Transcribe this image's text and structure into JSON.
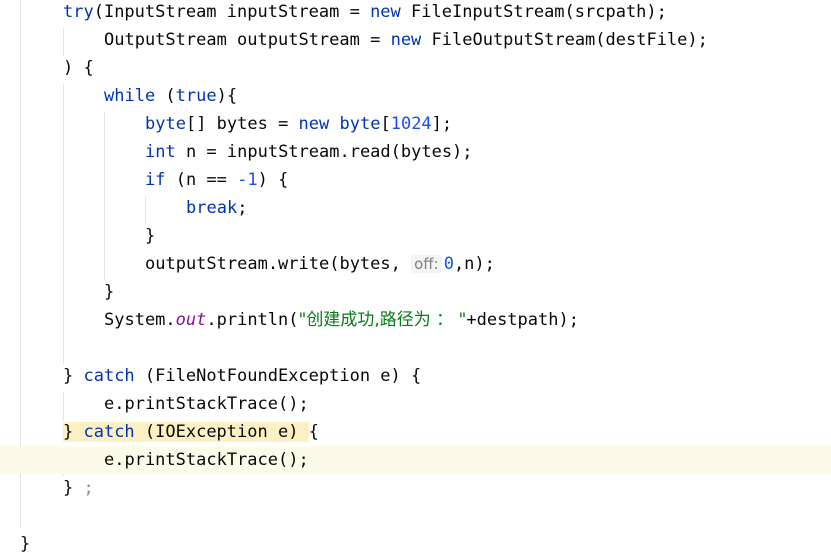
{
  "editor": {
    "lines": {
      "l1": {
        "t1": "try",
        "t2": "(InputStream inputStream = ",
        "t3": "new",
        "t4": " FileInputStream(srcpath);"
      },
      "l2": {
        "t1": "OutputStream outputStream = ",
        "t2": "new",
        "t3": " FileOutputStream(destFile);"
      },
      "l3": {
        "t1": ") {"
      },
      "l4": {
        "t1": "while",
        "t2": " (",
        "t3": "true",
        "t4": "){"
      },
      "l5": {
        "t1": "byte",
        "t2": "[] bytes = ",
        "t3": "new",
        "t4": " ",
        "t5": "byte",
        "t6": "[",
        "t7": "1024",
        "t8": "];"
      },
      "l6": {
        "t1": "int",
        "t2": " n = inputStream.read(bytes);"
      },
      "l7": {
        "t1": "if",
        "t2": " (n == ",
        "t3": "-1",
        "t4": ") {"
      },
      "l8": {
        "t1": "break",
        "t2": ";"
      },
      "l9": {
        "t1": "}"
      },
      "l10": {
        "t1": "outputStream.write(bytes, ",
        "hint": "off:",
        "t2": " ",
        "t3": "0",
        "t4": ",n);"
      },
      "l11": {
        "t1": "}"
      },
      "l12": {
        "t1": "System.",
        "t2": "out",
        "t3": ".println(",
        "t4": "\"创建成功,路径为 ： \"",
        "t5": "+destpath);"
      },
      "l14": {
        "t1": "} ",
        "t2": "catch",
        "t3": " (FileNotFoundException e) {"
      },
      "l15": {
        "t1": "e.printStackTrace();"
      },
      "l16": {
        "t1": "} ",
        "t2": "catch",
        "t3": " (IOException e) ",
        "t4": "{"
      },
      "l17": {
        "t1": "e.printStackTrace();"
      },
      "l18": {
        "t1": "} ",
        "t2": ";"
      },
      "l20": {
        "t1": "}"
      }
    }
  }
}
